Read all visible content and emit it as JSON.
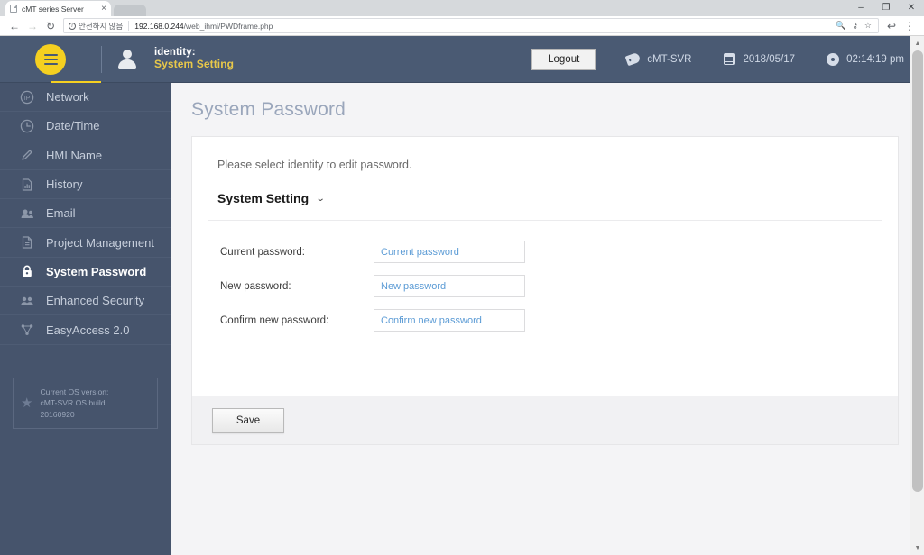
{
  "browser": {
    "tab": {
      "title": "cMT series Server",
      "favicon": "page-icon",
      "close": "×"
    },
    "window_controls": {
      "minimize": "–",
      "maximize": "❐",
      "close": "✕"
    },
    "nav": {
      "back": "←",
      "forward": "→",
      "reload": "↻"
    },
    "omnibox": {
      "security_label": "안전하지 않음",
      "info_icon": "i",
      "url_host": "192.168.0.244",
      "url_path": "/web_ihmi/PWDframe.php"
    },
    "omnibox_icons": {
      "zoom": "🔍",
      "key": "⚷",
      "star": "☆"
    },
    "toolbar_icons": {
      "share": "↩",
      "menu": "⋮"
    }
  },
  "header": {
    "menu_button": "hamburger-menu",
    "identity_label": "identity:",
    "identity_value": "System Setting",
    "logout_label": "Logout",
    "device_name": "cMT-SVR",
    "date": "2018/05/17",
    "time": "02:14:19 pm"
  },
  "sidebar": {
    "items": [
      {
        "label": "Network",
        "icon": "ip-icon",
        "active": false
      },
      {
        "label": "Date/Time",
        "icon": "clock-icon",
        "active": false
      },
      {
        "label": "HMI Name",
        "icon": "pencil-icon",
        "active": false
      },
      {
        "label": "History",
        "icon": "document-chart-icon",
        "active": false
      },
      {
        "label": "Email",
        "icon": "contacts-icon",
        "active": false
      },
      {
        "label": "Project Management",
        "icon": "document-icon",
        "active": false
      },
      {
        "label": "System Password",
        "icon": "lock-icon",
        "active": true
      },
      {
        "label": "Enhanced Security",
        "icon": "users-icon",
        "active": false
      },
      {
        "label": "EasyAccess 2.0",
        "icon": "network-nodes-icon",
        "active": false
      }
    ],
    "os_box": {
      "icon": "star-icon",
      "line1": "Current OS version:",
      "line2": "cMT-SVR OS build",
      "line3": "20160920"
    }
  },
  "main": {
    "page_title": "System Password",
    "intro": "Please select identity to edit password.",
    "identity_dropdown": {
      "value": "System Setting",
      "chevron": "⌄"
    },
    "fields": [
      {
        "label": "Current password:",
        "placeholder": "Current password",
        "value": ""
      },
      {
        "label": "New password:",
        "placeholder": "New password",
        "value": ""
      },
      {
        "label": "Confirm new password:",
        "placeholder": "Confirm new password",
        "value": ""
      }
    ],
    "save_label": "Save"
  },
  "scrollbar": {
    "up": "▲",
    "down": "▼"
  },
  "colors": {
    "header_bg": "#4a5a73",
    "sidebar_bg": "#46546c",
    "accent_yellow": "#f5d020",
    "identity_yellow": "#e8c84a",
    "placeholder_blue": "#5b9bd5",
    "title_gray": "#9aa6bb"
  }
}
